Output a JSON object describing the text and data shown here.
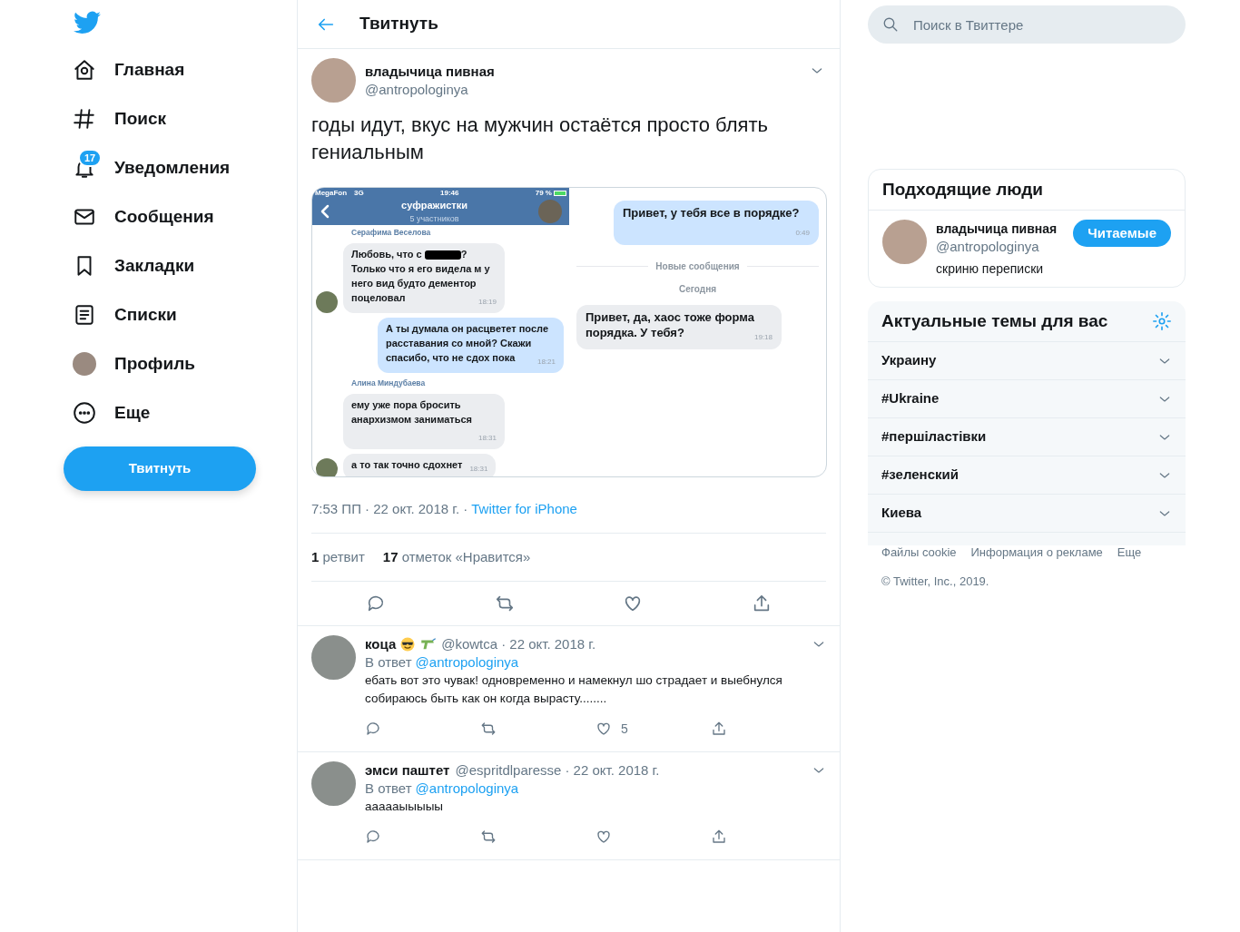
{
  "sidebar": {
    "items": [
      {
        "label": "Главная"
      },
      {
        "label": "Поиск"
      },
      {
        "label": "Уведомления",
        "badge": "17"
      },
      {
        "label": "Сообщения"
      },
      {
        "label": "Закладки"
      },
      {
        "label": "Списки"
      },
      {
        "label": "Профиль"
      },
      {
        "label": "Еще"
      }
    ],
    "tweet_button": "Твитнуть"
  },
  "header": {
    "title": "Твитнуть"
  },
  "tweet": {
    "name": "владычица пивная",
    "handle": "@antropologinya",
    "text": "годы идут, вкус на мужчин остаётся просто блять гениальным",
    "media": {
      "left": {
        "status": {
          "carrier": "MegaFon",
          "network": "3G",
          "time": "19:46",
          "battery": "79 %"
        },
        "chat_title": "суфражистки",
        "chat_subtitle": "5 участников",
        "messages": [
          {
            "kind": "sender",
            "text": "Серафима Веселова"
          },
          {
            "kind": "in",
            "avatar": true,
            "text_before": "Любовь, что с",
            "redacted": true,
            "text": "? Только что я его видела м у него вид будто дементор поцеловал",
            "time": "18:19"
          },
          {
            "kind": "out",
            "text": "А ты думала он расцветет после расставания со мной? Скажи спасибо, что не сдох пока",
            "time": "18:21"
          },
          {
            "kind": "sender",
            "text": "Алина Миндубаева"
          },
          {
            "kind": "in",
            "avatar": false,
            "text": "ему уже пора бросить анархизмом заниматься",
            "time": "18:31"
          },
          {
            "kind": "in",
            "avatar": true,
            "text": "а то так точно сдохнет",
            "time": "18:31"
          }
        ]
      },
      "right": {
        "messages": [
          {
            "kind": "out",
            "text": "Привет, у тебя все в порядке?",
            "time": "0:49"
          },
          {
            "kind": "separator",
            "text": "Новые сообщения"
          },
          {
            "kind": "date",
            "text": "Сегодня"
          },
          {
            "kind": "in",
            "text": "Привет, да, хаос тоже форма порядка. У тебя?",
            "time": "19:18"
          }
        ]
      }
    },
    "time": "7:53 ПП · 22 окт. 2018 г. ·",
    "source": "Twitter for iPhone",
    "stats": [
      {
        "count": "1",
        "label": "ретвит"
      },
      {
        "count": "17",
        "label": "отметок «Нравится»"
      }
    ]
  },
  "replies": [
    {
      "name": "коца",
      "handle": "@kowtca",
      "date": "· 22 окт. 2018 г.",
      "reply_label": "В ответ",
      "reply_to": "@antropologinya",
      "text": "ебать вот это чувак! одновременно и намекнул шо страдает и выебнулся собираюсь быть как он когда вырасту........",
      "likes": "5"
    },
    {
      "name": "эмси паштет",
      "handle": "@espritdlparesse",
      "date": "· 22 окт. 2018 г.",
      "reply_label": "В ответ",
      "reply_to": "@antropologinya",
      "text": "аааааыыыыы"
    }
  ],
  "search": {
    "placeholder": "Поиск в Твиттере"
  },
  "who_to_follow": {
    "title": "Подходящие люди",
    "people": [
      {
        "name": "владычица пивная",
        "handle": "@antropologinya",
        "bio": "скриню переписки",
        "button": "Читаемые"
      }
    ]
  },
  "trends": {
    "title": "Актуальные темы для вас",
    "items": [
      "Украину",
      "#Ukraine",
      "#першіластівки",
      "#зеленский",
      "Киева"
    ]
  },
  "footer": {
    "links": [
      "Файлы cookie",
      "Информация о рекламе",
      "Еще"
    ],
    "copyright": "© Twitter, Inc., 2019."
  }
}
